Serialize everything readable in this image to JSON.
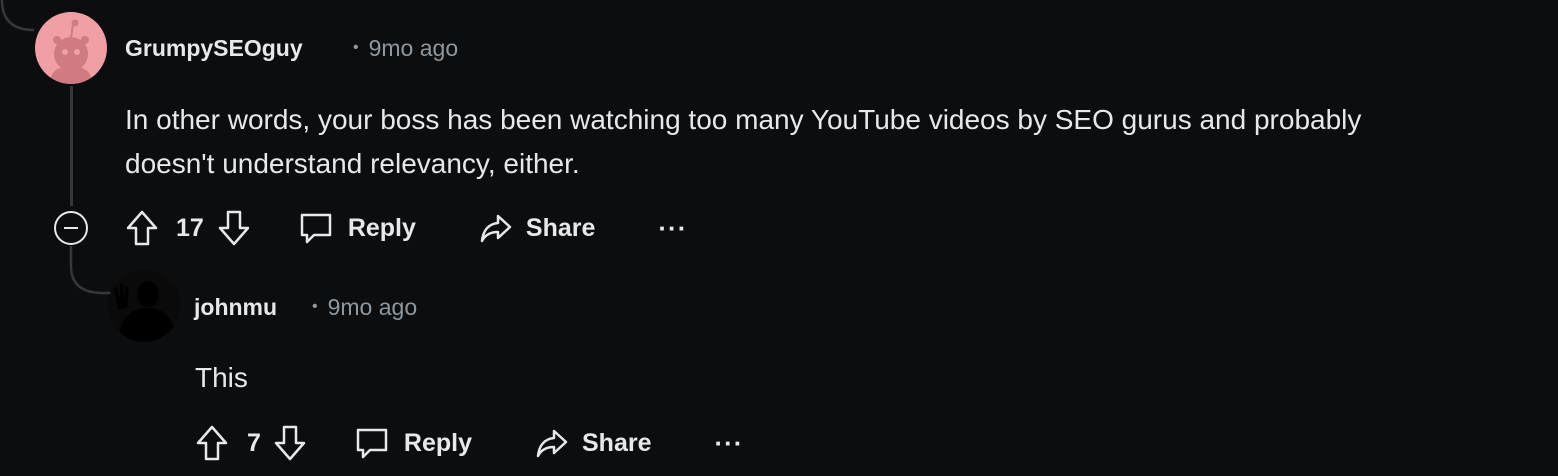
{
  "comments": [
    {
      "username": "GrumpySEOguy",
      "time": "9mo ago",
      "body_line1": "In other words, your boss has been watching too many YouTube videos by SEO gurus and probably",
      "body_line2": "doesn't understand relevancy, either.",
      "votes": "17",
      "reply_label": "Reply",
      "share_label": "Share",
      "more_label": "···",
      "avatar_color": "#f0a0a5"
    },
    {
      "username": "johnmu",
      "time": "9mo ago",
      "body": "This",
      "votes": "7",
      "reply_label": "Reply",
      "share_label": "Share",
      "more_label": "···"
    }
  ],
  "colors": {
    "background": "#0b0d0f",
    "text": "#e6e8ea",
    "meta": "#8f989f",
    "thread_line": "#33383d"
  },
  "icons": [
    "snoo-avatar",
    "collapse-icon",
    "upvote-icon",
    "downvote-icon",
    "comment-icon",
    "share-icon",
    "more-icon"
  ]
}
